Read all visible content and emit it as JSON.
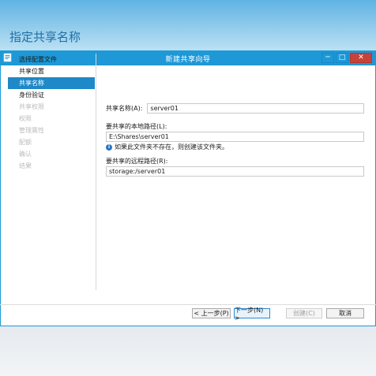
{
  "window": {
    "title": "新建共享向导",
    "controls": {
      "minimize": "─",
      "maximize": "□",
      "close": "✕"
    }
  },
  "page_heading": "指定共享名称",
  "steps": [
    {
      "label": "选择配置文件",
      "state": "normal"
    },
    {
      "label": "共享位置",
      "state": "normal"
    },
    {
      "label": "共享名称",
      "state": "active"
    },
    {
      "label": "身份验证",
      "state": "normal"
    },
    {
      "label": "共享权限",
      "state": "disabled"
    },
    {
      "label": "权限",
      "state": "disabled"
    },
    {
      "label": "管理属性",
      "state": "disabled"
    },
    {
      "label": "配额",
      "state": "disabled"
    },
    {
      "label": "确认",
      "state": "disabled"
    },
    {
      "label": "结果",
      "state": "disabled"
    }
  ],
  "form": {
    "share_name_label": "共享名称(A):",
    "share_name_value": "server01",
    "local_path_label": "要共享的本地路径(L):",
    "local_path_value": "E:\\Shares\\server01",
    "info_text": "如果此文件夹不存在，则创建该文件夹。",
    "remote_path_label": "要共享的远程路径(R):",
    "remote_path_value": "storage:/server01"
  },
  "buttons": {
    "prev": "< 上一步(P)",
    "next": "下一步(N) >",
    "create": "创建(C)",
    "cancel": "取消"
  },
  "colors": {
    "accent": "#1e98d7",
    "close": "#c7423b",
    "heading": "#1f6fa3"
  }
}
